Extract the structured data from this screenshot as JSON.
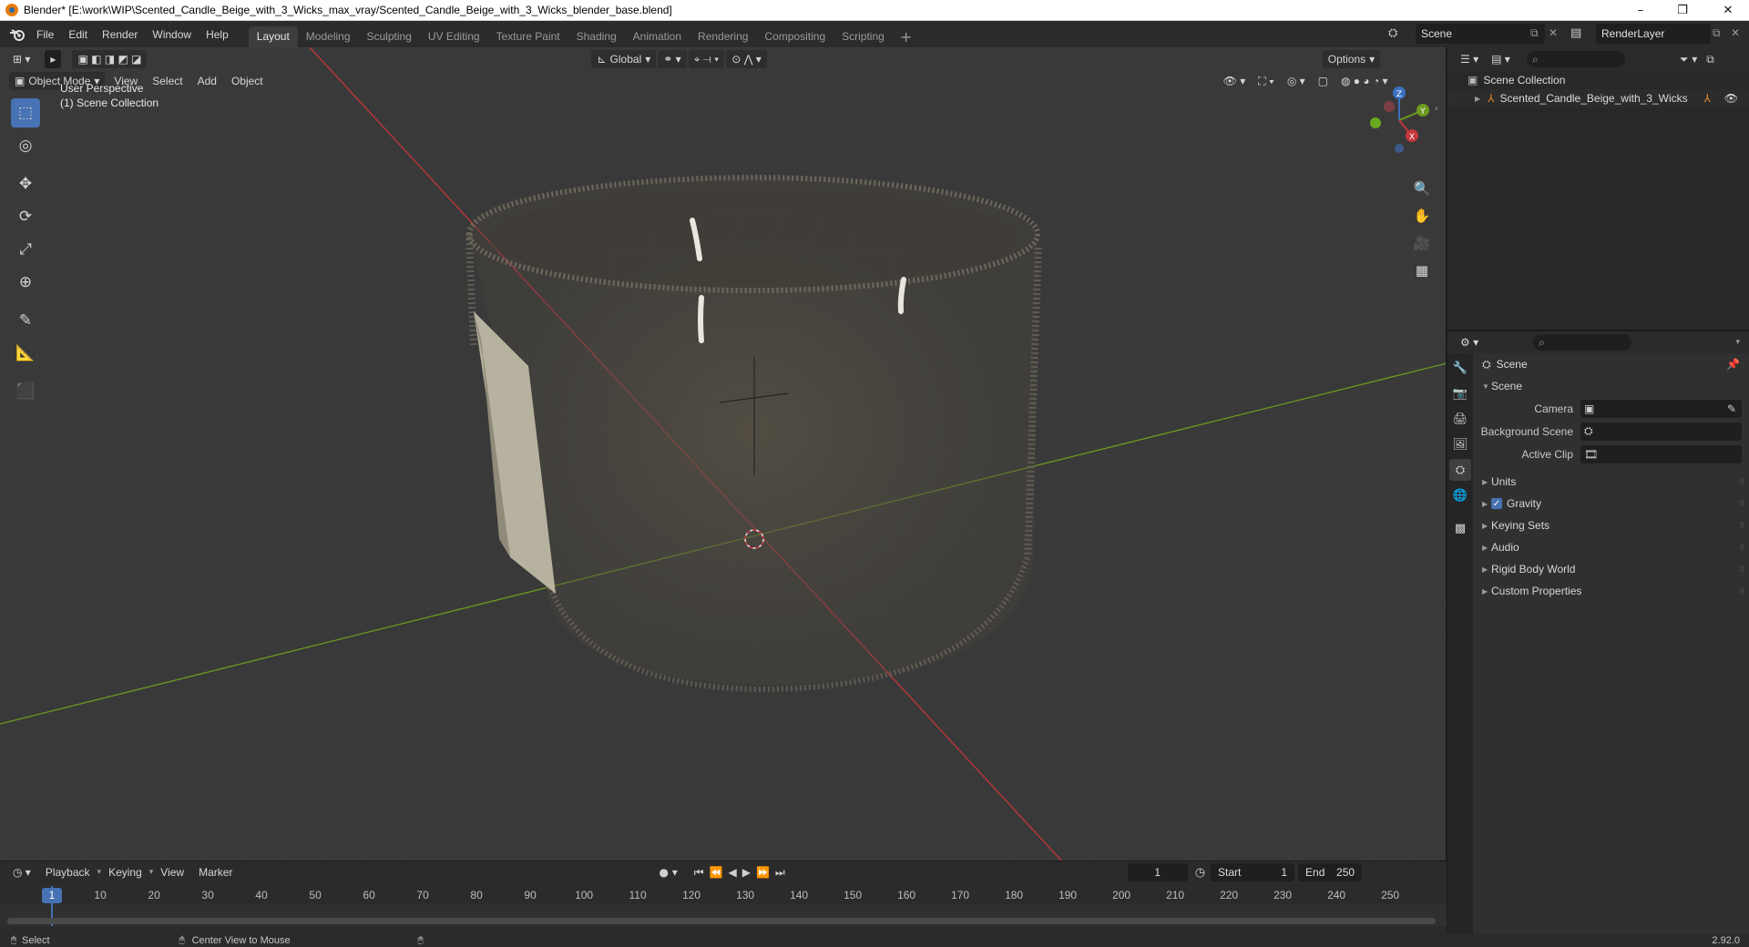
{
  "window": {
    "title": "Blender* [E:\\work\\WIP\\Scented_Candle_Beige_with_3_Wicks_max_vray/Scented_Candle_Beige_with_3_Wicks_blender_base.blend]",
    "minimize": "–",
    "maximize": "❐",
    "close": "✕"
  },
  "menu": {
    "items": [
      "File",
      "Edit",
      "Render",
      "Window",
      "Help"
    ]
  },
  "workspaces": {
    "tabs": [
      "Layout",
      "Modeling",
      "Sculpting",
      "UV Editing",
      "Texture Paint",
      "Shading",
      "Animation",
      "Rendering",
      "Compositing",
      "Scripting"
    ],
    "active": "Layout",
    "add": "+"
  },
  "scene_selector": {
    "value": "Scene"
  },
  "renderlayer_selector": {
    "value": "RenderLayer"
  },
  "viewport": {
    "mode": "Object Mode",
    "menus": [
      "View",
      "Select",
      "Add",
      "Object"
    ],
    "transform_orientation": "Global",
    "options": "Options",
    "perspective_label": "User Perspective",
    "collection_label": "(1) Scene Collection",
    "gizmo": {
      "x": "X",
      "y": "Y",
      "z": "Z"
    }
  },
  "timeline": {
    "menus": [
      "Playback",
      "Keying",
      "View",
      "Marker"
    ],
    "current_frame": "1",
    "start_label": "Start",
    "start_value": "1",
    "end_label": "End",
    "end_value": "250",
    "ruler": [
      "1",
      "10",
      "20",
      "30",
      "40",
      "50",
      "60",
      "70",
      "80",
      "90",
      "100",
      "110",
      "120",
      "130",
      "140",
      "150",
      "160",
      "170",
      "180",
      "190",
      "200",
      "210",
      "220",
      "230",
      "240",
      "250"
    ]
  },
  "statusbar": {
    "select": "Select",
    "center_view": "Center View to Mouse",
    "version": "2.92.0"
  },
  "outliner": {
    "root": "Scene Collection",
    "object": "Scented_Candle_Beige_with_3_Wicks"
  },
  "properties": {
    "context": "Scene",
    "panel": "Scene",
    "camera_label": "Camera",
    "background_scene_label": "Background Scene",
    "active_clip_label": "Active Clip",
    "subpanels": [
      "Units",
      "Gravity",
      "Keying Sets",
      "Audio",
      "Rigid Body World",
      "Custom Properties"
    ],
    "gravity_checked": true
  },
  "colors": {
    "x_axis": "#c4363c",
    "y_axis": "#6c9a1f",
    "accent": "#4772b3",
    "viewport_bg": "#393939"
  }
}
